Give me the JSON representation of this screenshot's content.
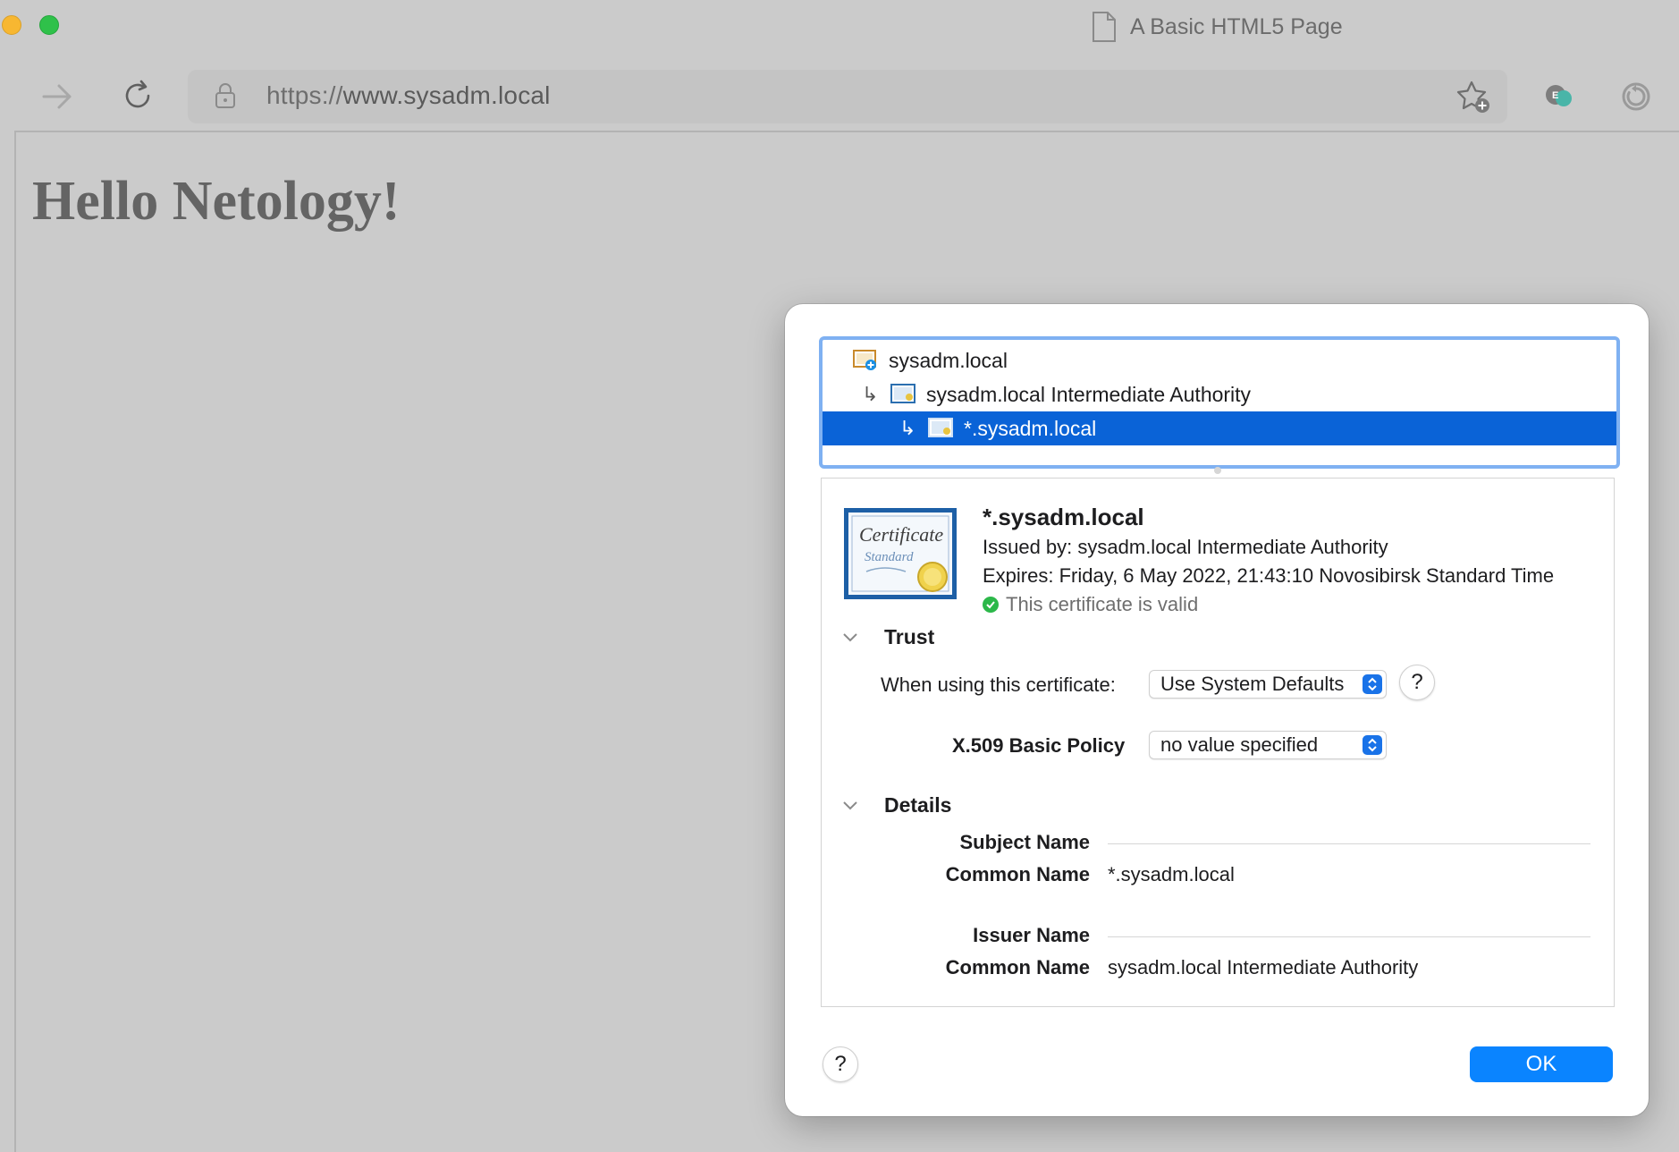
{
  "window": {
    "tab_title": "A Basic HTML5 Page"
  },
  "toolbar": {
    "url_scheme": "https://",
    "url_host": "www.sysadm.local",
    "icons": [
      "forward-arrow-icon",
      "reload-icon",
      "lock-icon",
      "add-favorite-icon",
      "extension-icon",
      "update-icon"
    ]
  },
  "page": {
    "heading": "Hello Netology!"
  },
  "dialog": {
    "tree": [
      {
        "label": "sysadm.local",
        "level": 0,
        "selected": false
      },
      {
        "label": "sysadm.local Intermediate Authority",
        "level": 1,
        "selected": false
      },
      {
        "label": "*.sysadm.local",
        "level": 2,
        "selected": true
      }
    ],
    "summary": {
      "name": "*.sysadm.local",
      "issued_by": "Issued by: sysadm.local Intermediate Authority",
      "expires": "Expires: Friday, 6 May 2022, 21:43:10 Novosibirsk Standard Time",
      "status": "This certificate is valid"
    },
    "trust": {
      "title": "Trust",
      "when_using_label": "When using this certificate:",
      "when_using_value": "Use System Defaults",
      "policy_label": "X.509 Basic Policy",
      "policy_value": "no value specified",
      "help": "?"
    },
    "details": {
      "title": "Details",
      "subject_name_label": "Subject Name",
      "subject_cn_label": "Common Name",
      "subject_cn_value": "*.sysadm.local",
      "issuer_name_label": "Issuer Name",
      "issuer_cn_label": "Common Name",
      "issuer_cn_value": "sysadm.local Intermediate Authority"
    },
    "help": "?",
    "ok_label": "OK"
  },
  "colors": {
    "selection": "#0a63d7",
    "ok_button": "#0a84ff",
    "valid": "#2cb84a"
  }
}
